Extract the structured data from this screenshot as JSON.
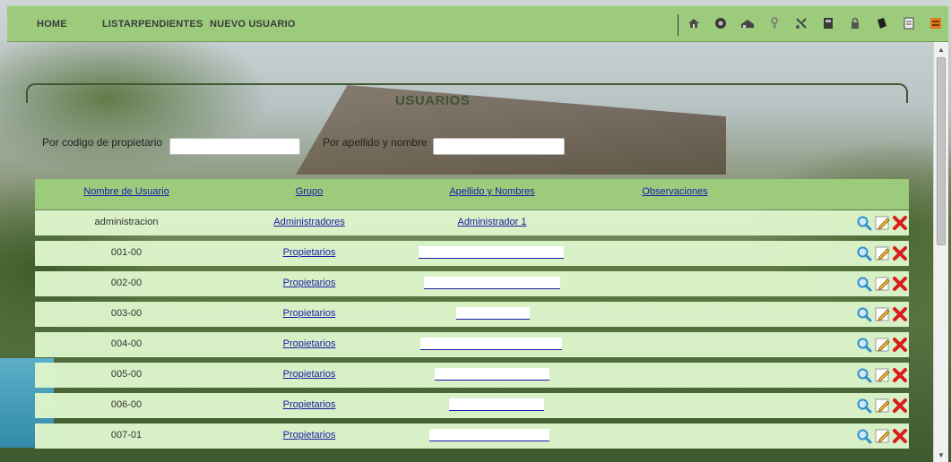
{
  "nav": {
    "home": "HOME",
    "pending": "LISTARPENDIENTES",
    "new_user": "NUEVO USUARIO"
  },
  "toolbar_icons": [
    "house-icon",
    "gear-icon",
    "building-icon",
    "key-icon",
    "tools-icon",
    "folder-icon",
    "lock-icon",
    "book-icon",
    "document-icon",
    "archive-icon"
  ],
  "page": {
    "title": "USUARIOS"
  },
  "filters": {
    "by_code_label": "Por codigo de propietario",
    "by_name_label": "Por apellido y nombre",
    "by_code_value": "",
    "by_name_value": ""
  },
  "table": {
    "columns": [
      "Nombre de Usuario",
      "Grupo",
      "Apellido y Nombres",
      "Observaciones"
    ],
    "rows": [
      {
        "user": "administracion",
        "group": "Administradores",
        "name": "Administrador 1",
        "obs": ""
      },
      {
        "user": "001-00",
        "group": "Propietarios",
        "name": "",
        "obs": ""
      },
      {
        "user": "002-00",
        "group": "Propietarios",
        "name": "",
        "obs": ""
      },
      {
        "user": "003-00",
        "group": "Propietarios",
        "name": "",
        "obs": ""
      },
      {
        "user": "004-00",
        "group": "Propietarios",
        "name": "",
        "obs": ""
      },
      {
        "user": "005-00",
        "group": "Propietarios",
        "name": "",
        "obs": ""
      },
      {
        "user": "006-00",
        "group": "Propietarios",
        "name": "",
        "obs": ""
      },
      {
        "user": "007-01",
        "group": "Propietarios",
        "name": "",
        "obs": ""
      }
    ]
  },
  "colors": {
    "bar_green": "#9ccb7c",
    "row_green": "#def6cb",
    "link_blue": "#1a1aa8",
    "title_green": "#3e5533",
    "delete_red": "#d81d1d"
  }
}
